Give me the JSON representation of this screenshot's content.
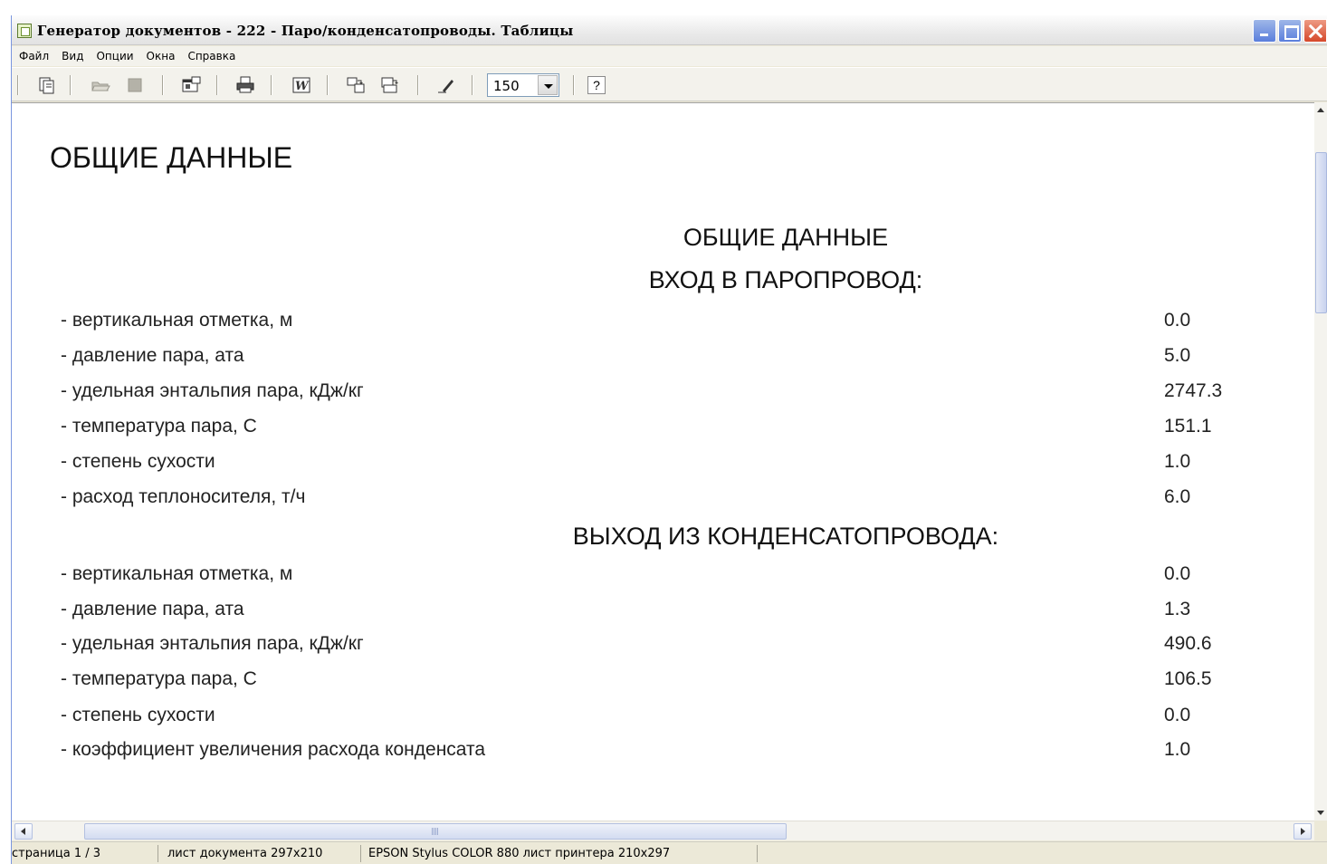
{
  "window": {
    "title": "Генератор документов - 222 - Паро/конденсатопроводы. Таблицы"
  },
  "menu": [
    "Файл",
    "Вид",
    "Опции",
    "Окна",
    "Справка"
  ],
  "toolbar": {
    "icons": [
      "pages-icon",
      "open-icon",
      "stop-icon",
      "properties-icon",
      "print-icon",
      "word-export-icon",
      "copy-page-icon",
      "paste-page-icon",
      "pen-icon",
      "help-icon"
    ],
    "zoom_value": "150",
    "help_label": "?"
  },
  "document": {
    "heading": "ОБЩИЕ ДАННЫЕ",
    "title": "ОБЩИЕ ДАННЫЕ",
    "section_inlet": "ВХОД В ПАРОПРОВОД:",
    "inlet_rows": [
      {
        "label": "- вертикальная отметка, м",
        "value": "0.0"
      },
      {
        "label": "- давление пара, ата",
        "value": "5.0"
      },
      {
        "label": "- удельная энтальпия пара, кДж/кг",
        "value": "2747.3"
      },
      {
        "label": "- температура пара, С",
        "value": "151.1"
      },
      {
        "label": "- степень сухости",
        "value": "1.0"
      },
      {
        "label": "- расход теплоносителя, т/ч",
        "value": "6.0"
      }
    ],
    "section_outlet": "ВЫХОД ИЗ КОНДЕНСАТОПРОВОДА:",
    "outlet_rows": [
      {
        "label": "- вертикальная отметка, м",
        "value": "0.0"
      },
      {
        "label": "- давление пара, ата",
        "value": "1.3"
      },
      {
        "label": "- удельная энтальпия пара, кДж/кг",
        "value": "490.6"
      },
      {
        "label": "- температура пара, С",
        "value": "106.5"
      },
      {
        "label": "- степень сухости",
        "value": "0.0"
      },
      {
        "label": "- коэффициент увеличения расхода конденсата",
        "value": "1.0"
      }
    ]
  },
  "status": {
    "page": "страница 1 / 3",
    "doc_sheet": "лист документа 297x210",
    "printer": "EPSON Stylus COLOR 880  лист принтера 210x297"
  }
}
